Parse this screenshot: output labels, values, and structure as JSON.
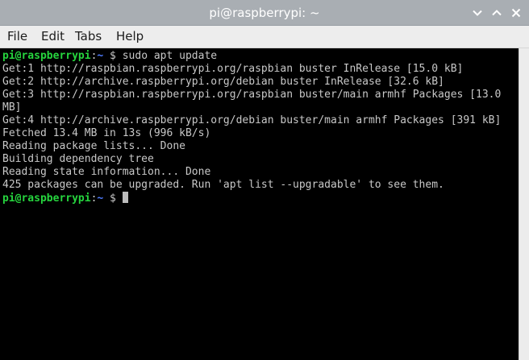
{
  "window": {
    "title": "pi@raspberrypi: ~",
    "controls": [
      "chevron-down-icon",
      "chevron-up-icon",
      "close-icon"
    ],
    "titlebar_color": "#a9aeb3"
  },
  "menu": {
    "items": [
      "File",
      "Edit",
      "Tabs",
      "Help"
    ]
  },
  "terminal": {
    "prompt_user": "pi@raspberrypi",
    "prompt_colon": ":",
    "prompt_path": "~",
    "prompt_symbol": " $ ",
    "command": "sudo apt update",
    "output": [
      "Get:1 http://raspbian.raspberrypi.org/raspbian buster InRelease [15.0 kB]",
      "Get:2 http://archive.raspberrypi.org/debian buster InRelease [32.6 kB]",
      "Get:3 http://raspbian.raspberrypi.org/raspbian buster/main armhf Packages [13.0",
      "MB]",
      "Get:4 http://archive.raspberrypi.org/debian buster/main armhf Packages [391 kB]",
      "Fetched 13.4 MB in 13s (996 kB/s)",
      "Reading package lists... Done",
      "Building dependency tree",
      "Reading state information... Done",
      "425 packages can be upgraded. Run 'apt list --upgradable' to see them."
    ],
    "colors": {
      "background": "#000000",
      "text": "#c8c8c8",
      "user": "#26d53e",
      "path": "#4f7bff"
    }
  }
}
